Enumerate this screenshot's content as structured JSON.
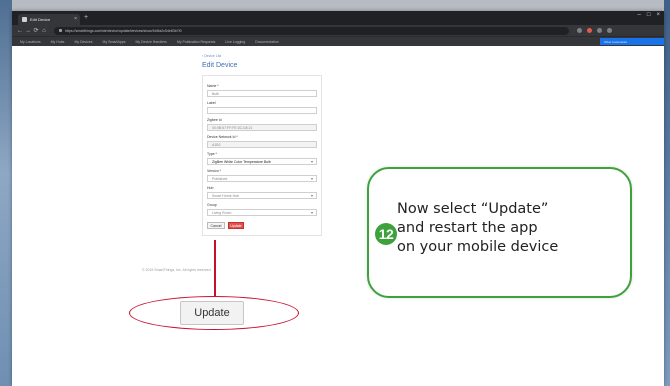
{
  "browser": {
    "tab_title": "Edit Device",
    "tab_close": "×",
    "new_tab": "+",
    "window_controls": [
      "–",
      "□",
      "×"
    ],
    "url": "https://smartthings.com/ide/device/update/devices/show/1fd9a2c54e83b7f0",
    "nav": [
      "←",
      "→",
      "⟳",
      "⌂"
    ],
    "bookmarks": [
      "My Locations",
      "My Hubs",
      "My Devices",
      "My SmartApps",
      "My Device Handlers",
      "My Publication Requests",
      "Live Logging",
      "Documentation"
    ],
    "bookmark_right": "Other bookmarks"
  },
  "page": {
    "breadcrumb": "‹ Device List",
    "title": "Edit Device",
    "fields": [
      {
        "label": "Name *",
        "value": "Bulb",
        "state": "normal"
      },
      {
        "label": "Label",
        "value": "",
        "state": "normal"
      },
      {
        "label": "Zigbee Id",
        "value": "00:0B:57:FF:FE:3C:D8:21",
        "state": "disabled"
      },
      {
        "label": "Device Network Id *",
        "value": "A1B2",
        "state": "disabled"
      },
      {
        "label": "Type *",
        "value": "ZigBee White Color Temperature Bulb",
        "state": "select-dark"
      },
      {
        "label": "Version *",
        "value": "Published",
        "state": "select"
      },
      {
        "label": "Hub",
        "value": "Smart Home Hub",
        "state": "select"
      },
      {
        "label": "Group",
        "value": "Living Room",
        "state": "select"
      }
    ],
    "cancel_label": "Cancel",
    "update_label": "Update",
    "footer": "© 2019 SmartThings, Inc. All rights reserved."
  },
  "annotation": {
    "update_button_label": "Update",
    "step_number": "12",
    "callout_lines": [
      "Now select “Update”",
      "and restart the app",
      "on your mobile device"
    ],
    "colors": {
      "callout_border": "#3da23c",
      "highlight": "#c8102e",
      "save_button": "#d9534f"
    }
  }
}
